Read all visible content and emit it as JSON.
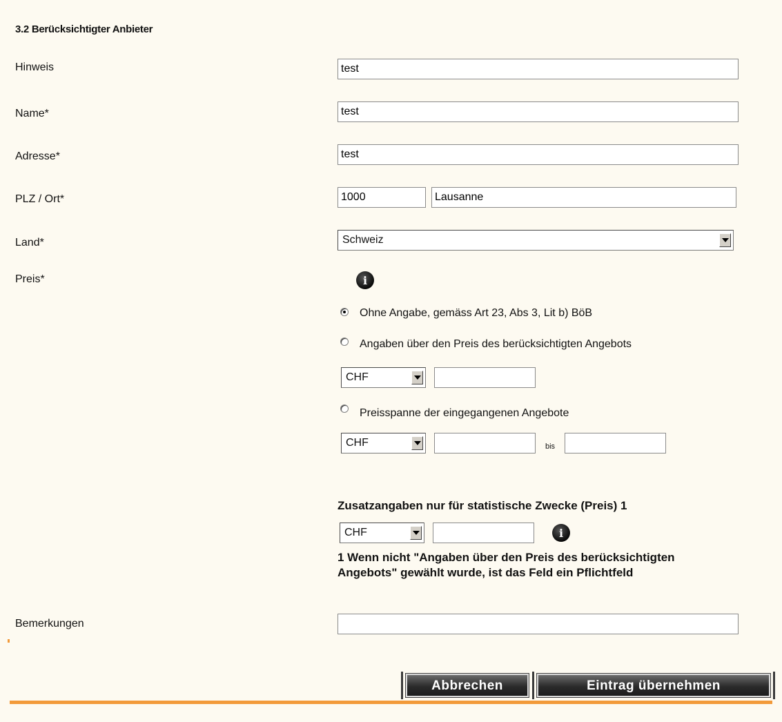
{
  "section": {
    "title": "3.2 Berücksichtigter Anbieter"
  },
  "fields": {
    "hinweis": {
      "label": "Hinweis",
      "value": "test"
    },
    "name": {
      "label": "Name*",
      "value": "test"
    },
    "adresse": {
      "label": "Adresse*",
      "value": "test"
    },
    "plz_ort": {
      "label": "PLZ / Ort*",
      "plz": "1000",
      "ort": "Lausanne"
    },
    "land": {
      "label": "Land*",
      "value": "Schweiz"
    },
    "preis": {
      "label": "Preis*"
    }
  },
  "price_options": [
    {
      "label": "Ohne Angabe, gemäss Art 23, Abs 3, Lit b) BöB",
      "checked": true
    },
    {
      "label": "Angaben über den Preis des berücksichtigten Angebots",
      "checked": false
    },
    {
      "label": "Preisspanne der eingegangenen Angebote",
      "checked": false
    }
  ],
  "currency": {
    "price": "CHF",
    "range": "CHF",
    "stat": "CHF"
  },
  "range_separator": "bis",
  "statistics": {
    "heading": "Zusatzangaben nur für statistische Zwecke (Preis) 1",
    "note": "1 Wenn nicht \"Angaben über den Preis des berücksichtigten Angebots\" gewählt wurde, ist das Feld ein Pflichtfeld"
  },
  "bemerkungen": {
    "label": "Bemerkungen",
    "value": ""
  },
  "buttons": {
    "cancel": "Abbrechen",
    "submit": "Eintrag übernehmen"
  },
  "icons": {
    "info": "i"
  },
  "colors": {
    "background": "#fdfaf1",
    "accent_line": "#f29a3a",
    "button": "#2b2b2b"
  }
}
